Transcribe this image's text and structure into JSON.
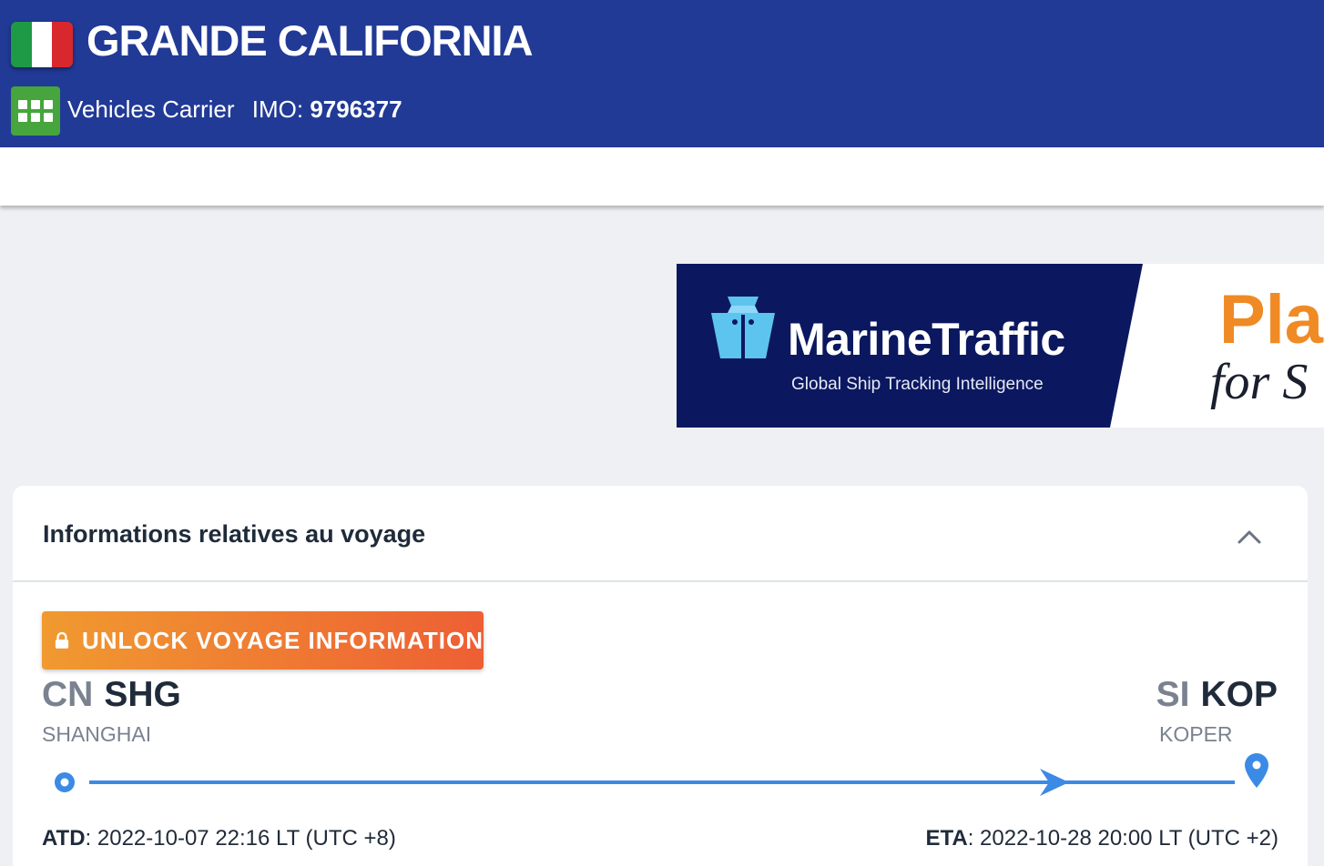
{
  "header": {
    "flag_country": "Italy",
    "flag_colors": [
      "#1e9a47",
      "#ffffff",
      "#d8282d"
    ],
    "ship_name": "GRANDE CALIFORNIA",
    "vessel_type": "Vehicles Carrier",
    "vessel_type_icon": "grid-icon",
    "imo_label": "IMO:",
    "imo_value": "9796377",
    "background_color": "#213a96"
  },
  "banner": {
    "brand": "MarineTraffic",
    "tagline": "Global Ship Tracking Intelligence",
    "promo_line1": "Pla",
    "promo_line2": "for S"
  },
  "voyage": {
    "section_title": "Informations relatives au voyage",
    "unlock_label": "UNLOCK VOYAGE INFORMATION",
    "origin": {
      "country_code": "CN",
      "port_code": "SHG",
      "port_name": "SHANGHAI"
    },
    "destination": {
      "country_code": "SI",
      "port_code": "KOP",
      "port_name": "KOPER"
    },
    "atd_label": "ATD",
    "atd_value": ": 2022-10-07 22:16 LT (UTC +8)",
    "eta_label": "ETA",
    "eta_value": ": 2022-10-28 20:00 LT (UTC +2)",
    "route_color": "#3b8ae6",
    "accent_gradient": [
      "#f09a30",
      "#ee5f34"
    ]
  }
}
